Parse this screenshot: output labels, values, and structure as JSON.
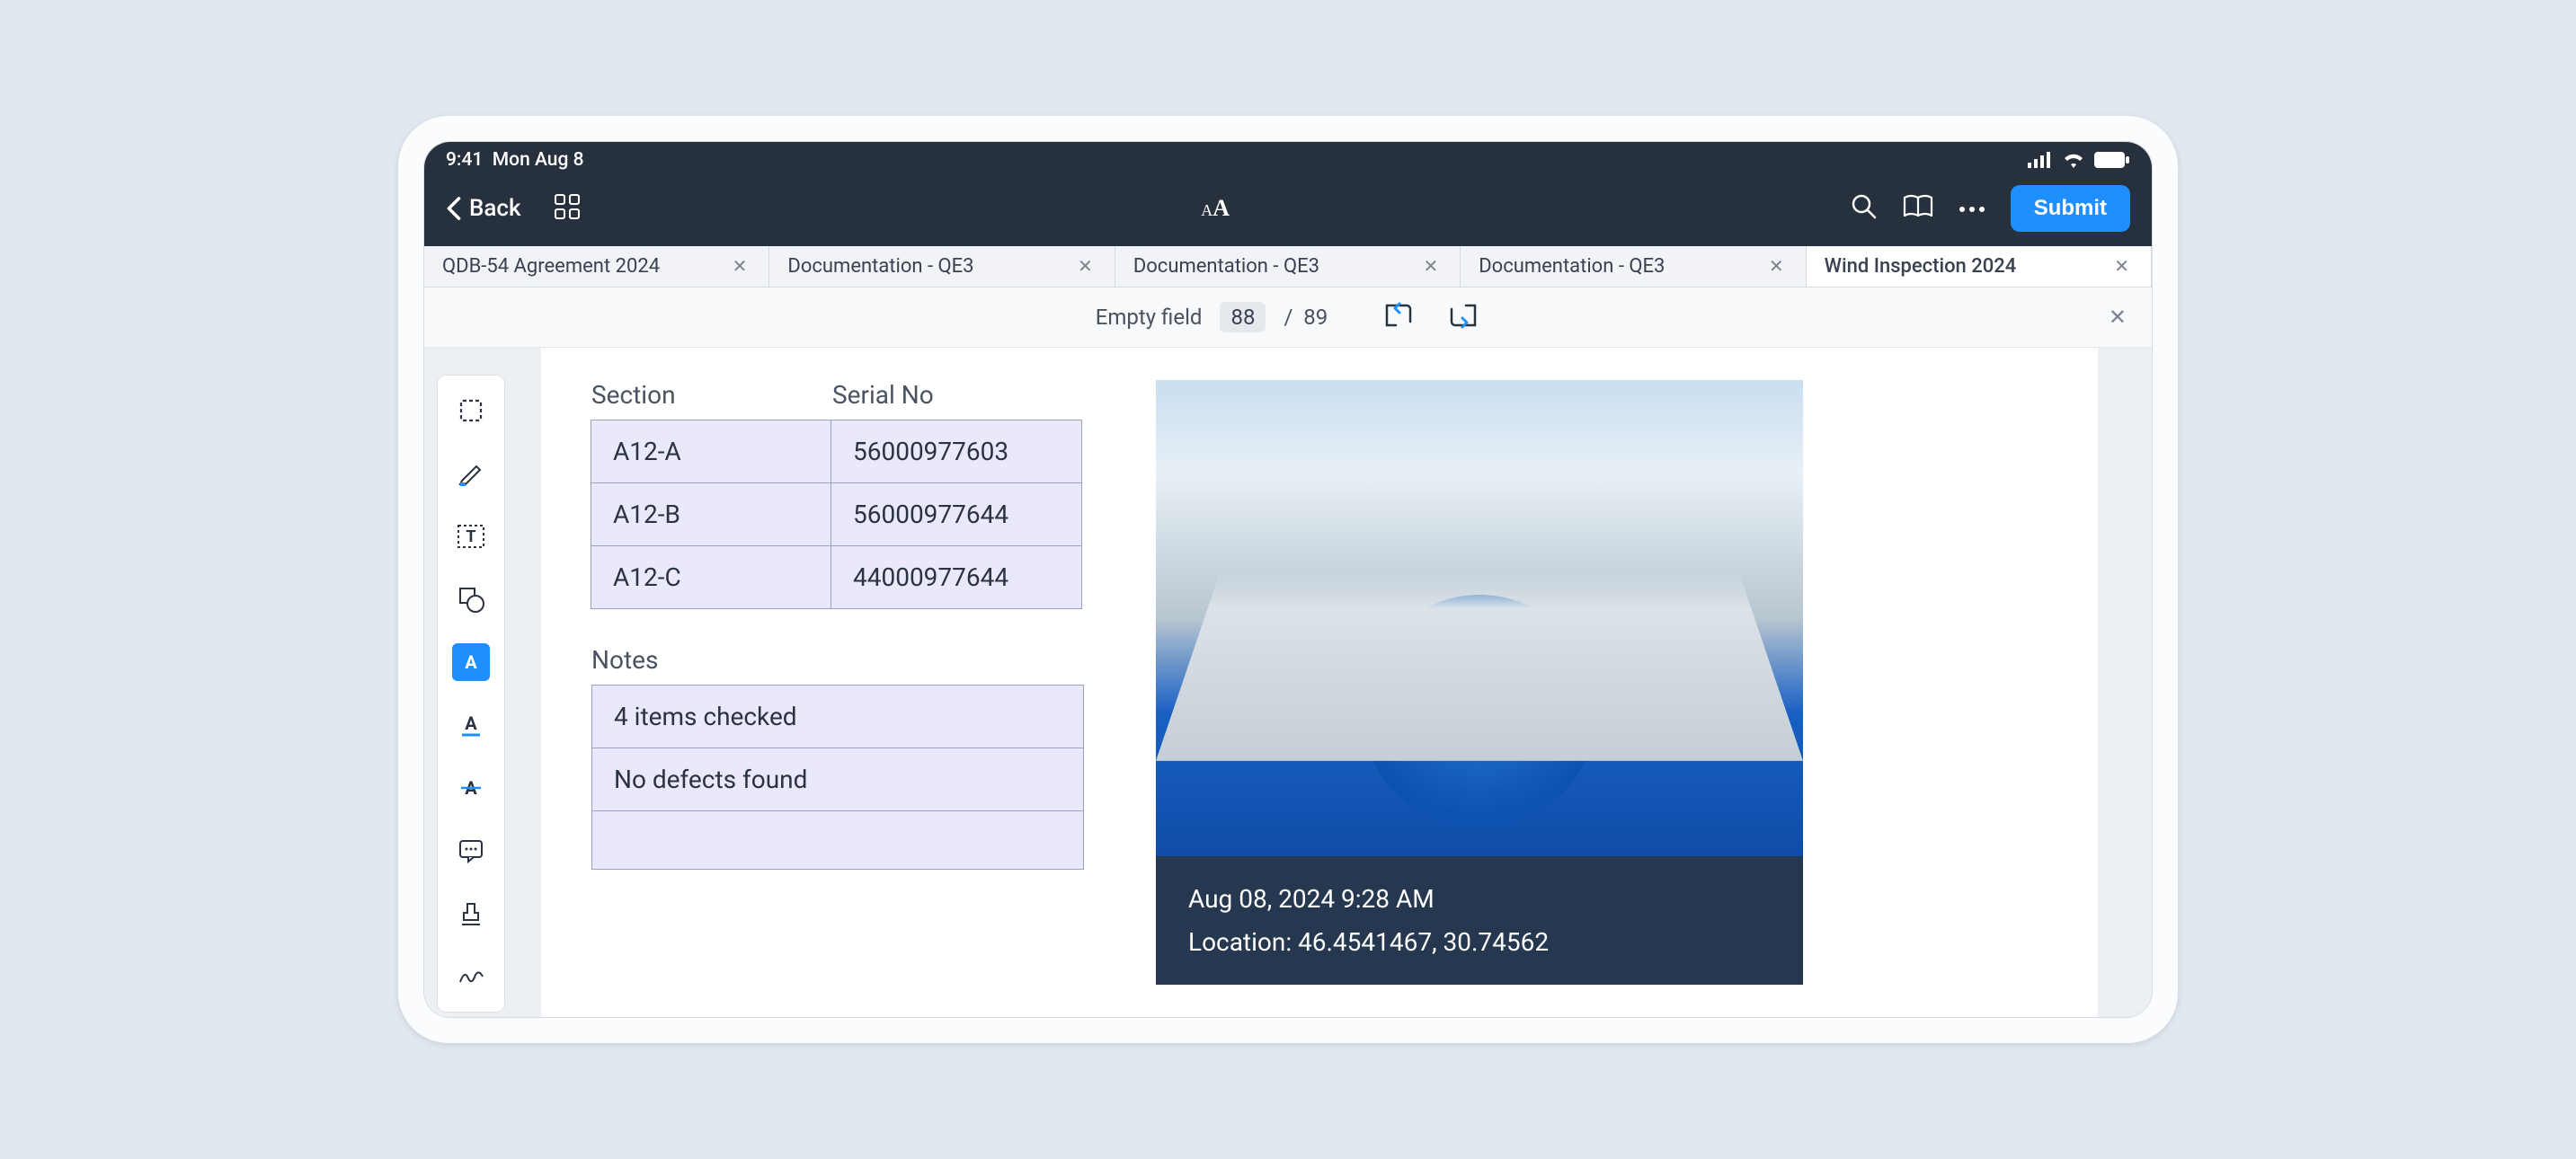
{
  "status": {
    "time": "9:41",
    "date": "Mon Aug 8"
  },
  "topnav": {
    "back": "Back",
    "submit": "Submit"
  },
  "tabs": [
    {
      "label": "QDB-54 Agreement 2024",
      "active": false
    },
    {
      "label": "Documentation - QE3",
      "active": false
    },
    {
      "label": "Documentation - QE3",
      "active": false
    },
    {
      "label": "Documentation - QE3",
      "active": false
    },
    {
      "label": "Wind Inspection 2024",
      "active": true
    }
  ],
  "fieldnav": {
    "label": "Empty field",
    "current": "88",
    "total": "89"
  },
  "table": {
    "headers": {
      "section": "Section",
      "serial": "Serial No"
    },
    "rows": [
      {
        "section": "A12-A",
        "serial": "56000977603"
      },
      {
        "section": "A12-B",
        "serial": "56000977644"
      },
      {
        "section": "A12-C",
        "serial": "44000977644"
      }
    ]
  },
  "notes": {
    "header": "Notes",
    "rows": [
      "4 items checked",
      "No defects found",
      ""
    ]
  },
  "photo": {
    "timestamp": "Aug 08, 2024 9:28 AM",
    "location_label": "Location: ",
    "location": "46.4541467, 30.74562"
  },
  "colors": {
    "accent": "#1f8fff",
    "navbg": "#27303d",
    "cellbg": "#e9e9fb",
    "cellborder": "#9aa2c4"
  }
}
